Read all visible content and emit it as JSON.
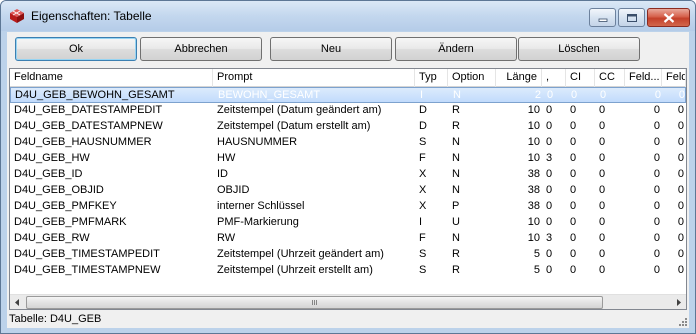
{
  "window": {
    "title": "Eigenschaften: Tabelle"
  },
  "toolbar": {
    "ok": "Ok",
    "cancel": "Abbrechen",
    "new": "Neu",
    "edit": "Ändern",
    "delete": "Löschen"
  },
  "table": {
    "headers": [
      "Feldname",
      "Prompt",
      "Typ",
      "Option",
      "Länge",
      ",",
      "CI",
      "CC",
      "Feld...",
      "Feld."
    ],
    "rows": [
      [
        "D4U_GEB_BEWOHN_GESAMT",
        "BEWOHN_GESAMT",
        "I",
        "N",
        "2",
        "0",
        "0",
        "0",
        "0",
        "0"
      ],
      [
        "D4U_GEB_DATESTAMPEDIT",
        "Zeitstempel (Datum geändert am)",
        "D",
        "R",
        "10",
        "0",
        "0",
        "0",
        "0",
        "0"
      ],
      [
        "D4U_GEB_DATESTAMPNEW",
        "Zeitstempel (Datum erstellt am)",
        "D",
        "R",
        "10",
        "0",
        "0",
        "0",
        "0",
        "0"
      ],
      [
        "D4U_GEB_HAUSNUMMER",
        "HAUSNUMMER",
        "S",
        "N",
        "10",
        "0",
        "0",
        "0",
        "0",
        "0"
      ],
      [
        "D4U_GEB_HW",
        "HW",
        "F",
        "N",
        "10",
        "3",
        "0",
        "0",
        "0",
        "0"
      ],
      [
        "D4U_GEB_ID",
        "ID",
        "X",
        "N",
        "38",
        "0",
        "0",
        "0",
        "0",
        "0"
      ],
      [
        "D4U_GEB_OBJID",
        "OBJID",
        "X",
        "N",
        "38",
        "0",
        "0",
        "0",
        "0",
        "0"
      ],
      [
        "D4U_GEB_PMFKEY",
        "interner Schlüssel",
        "X",
        "P",
        "38",
        "0",
        "0",
        "0",
        "0",
        "0"
      ],
      [
        "D4U_GEB_PMFMARK",
        "PMF-Markierung",
        "I",
        "U",
        "10",
        "0",
        "0",
        "0",
        "0",
        "0"
      ],
      [
        "D4U_GEB_RW",
        "RW",
        "F",
        "N",
        "10",
        "3",
        "0",
        "0",
        "0",
        "0"
      ],
      [
        "D4U_GEB_TIMESTAMPEDIT",
        "Zeitstempel (Uhrzeit geändert am)",
        "S",
        "R",
        "5",
        "0",
        "0",
        "0",
        "0",
        "0"
      ],
      [
        "D4U_GEB_TIMESTAMPNEW",
        "Zeitstempel (Uhrzeit erstellt am)",
        "S",
        "R",
        "5",
        "0",
        "0",
        "0",
        "0",
        "0"
      ]
    ],
    "selected_row": 0
  },
  "scrollbar": {
    "grip": "III"
  },
  "status": {
    "text": "Tabelle: D4U_GEB"
  },
  "icons": {
    "app": "app-cube-icon",
    "minimize": "minimize-icon",
    "maximize": "maximize-icon",
    "close": "close-icon",
    "scroll_left": "arrow-left-icon",
    "scroll_right": "arrow-right-icon",
    "resize": "resize-grip-icon"
  },
  "colors": {
    "selection": "#c1dbfc",
    "close_button": "#c4402a",
    "titlebar": "#c3d7ee"
  }
}
